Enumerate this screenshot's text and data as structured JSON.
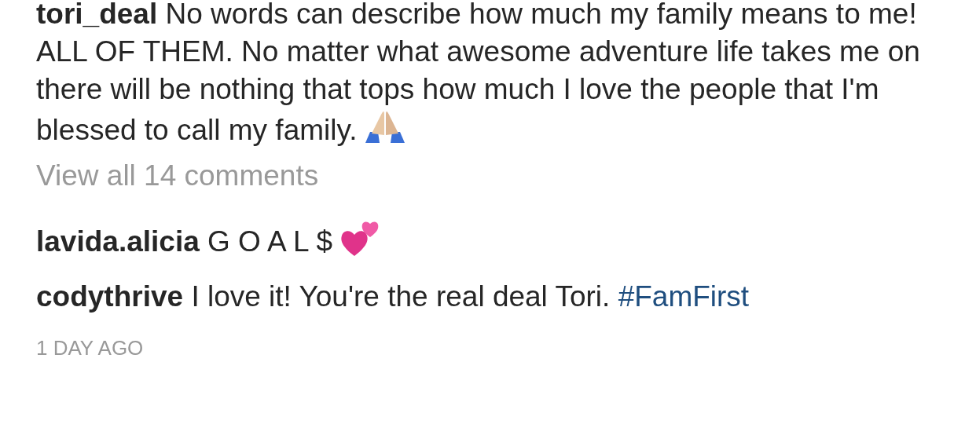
{
  "caption": {
    "username": "tori_deal",
    "text": "No words can describe how much my family means to me! ALL OF THEM. No matter what awesome adventure life takes me on there will be nothing that tops how much I love the people that I'm blessed to call my family.",
    "trailing": [
      {
        "kind": "praying_hands"
      }
    ]
  },
  "view_comments": "View all 14 comments",
  "comments": [
    {
      "username": "lavida.alicia",
      "segments": [
        {
          "kind": "text",
          "text": "G O A L $"
        },
        {
          "kind": "hearts"
        }
      ]
    },
    {
      "username": "codythrive",
      "segments": [
        {
          "kind": "text",
          "text": "I love it! You're the real deal Tori."
        },
        {
          "kind": "hashtag",
          "text": "#FamFirst"
        }
      ]
    }
  ],
  "timestamp": "1 DAY AGO"
}
